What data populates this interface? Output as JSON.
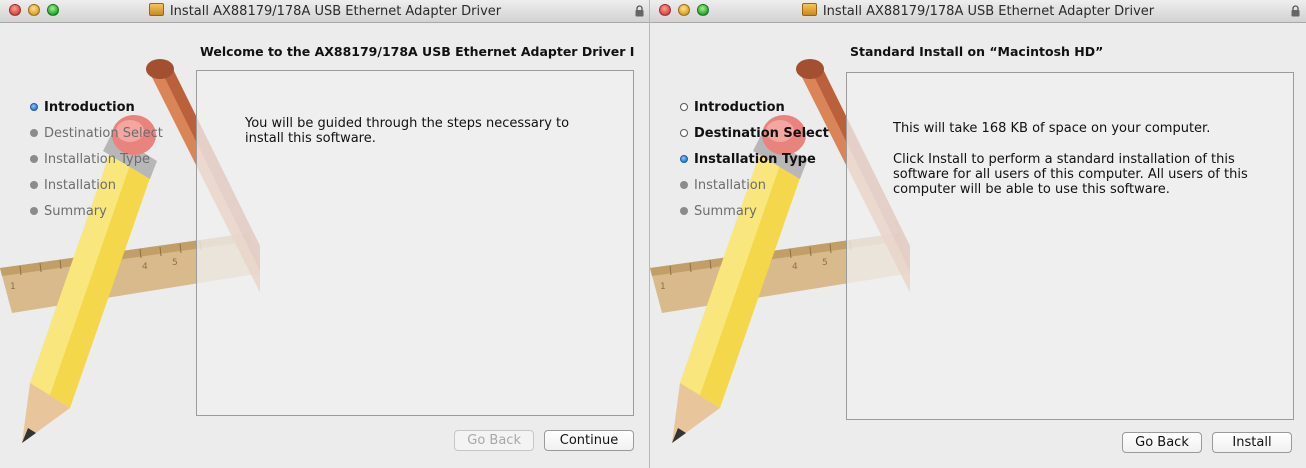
{
  "background_text": "",
  "windows": [
    {
      "title": "Install AX88179/178A USB Ethernet Adapter Driver",
      "heading": "Welcome to the AX88179/178A USB Ethernet Adapter Driver I",
      "steps": [
        {
          "label": "Introduction",
          "state": "current"
        },
        {
          "label": "Destination Select",
          "state": "pending"
        },
        {
          "label": "Installation Type",
          "state": "pending"
        },
        {
          "label": "Installation",
          "state": "pending"
        },
        {
          "label": "Summary",
          "state": "pending"
        }
      ],
      "body": [
        "You will be guided through the steps necessary to install this software."
      ],
      "buttons": {
        "back": "Go Back",
        "primary": "Continue"
      }
    },
    {
      "title": "Install AX88179/178A USB Ethernet Adapter Driver",
      "heading": "Standard Install on “Macintosh HD”",
      "steps": [
        {
          "label": "Introduction",
          "state": "done"
        },
        {
          "label": "Destination Select",
          "state": "done"
        },
        {
          "label": "Installation Type",
          "state": "current"
        },
        {
          "label": "Installation",
          "state": "pending"
        },
        {
          "label": "Summary",
          "state": "pending"
        }
      ],
      "body": [
        "This will take 168 KB of space on your computer.",
        "Click Install to perform a standard installation of this software for all users of this computer. All users of this computer will be able to use this software."
      ],
      "buttons": {
        "back": "Go Back",
        "primary": "Install"
      }
    }
  ],
  "icons": [
    "close-icon",
    "minimize-icon",
    "zoom-icon",
    "package-icon",
    "lock-icon",
    "step-bullet-icon"
  ],
  "colors": {
    "current_step": "#2d7bd8",
    "window_bg": "#ececec",
    "close": "#e0443e",
    "minimize": "#dea123",
    "zoom": "#1aab29"
  }
}
